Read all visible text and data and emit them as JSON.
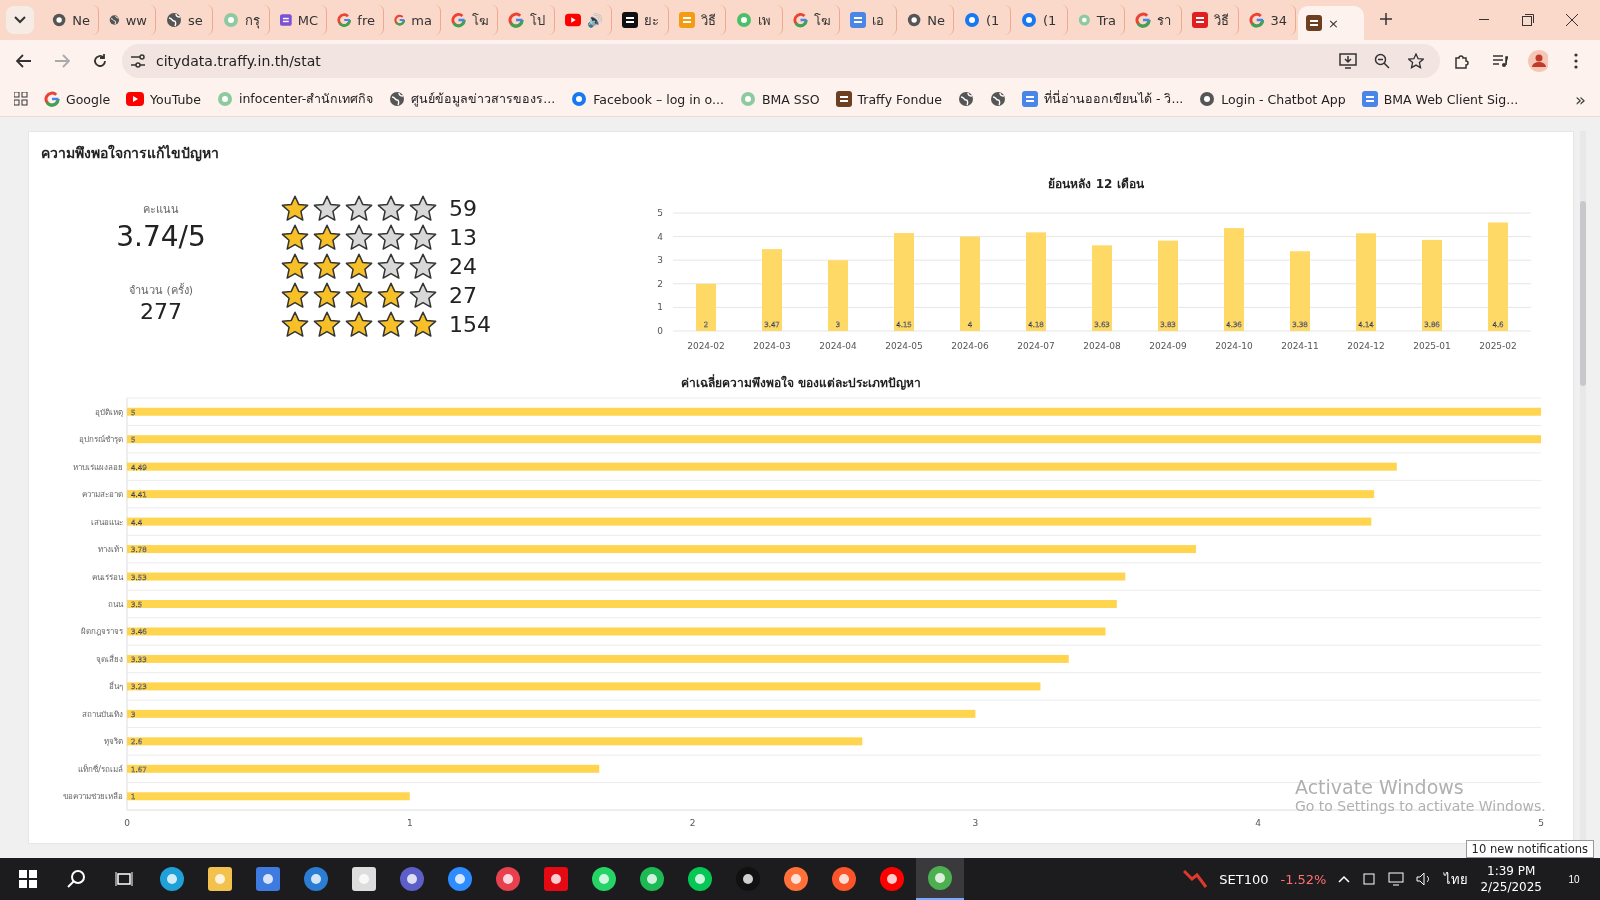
{
  "browser": {
    "tabs": [
      {
        "kind": "chrome",
        "label": "Ne",
        "selected": false
      },
      {
        "kind": "globe",
        "label": "ww",
        "selected": false
      },
      {
        "kind": "globe",
        "label": "se",
        "selected": false
      },
      {
        "kind": "emblem",
        "label": "กรุ",
        "selected": false
      },
      {
        "kind": "printer",
        "label": "MC",
        "selected": false
      },
      {
        "kind": "google",
        "label": "fre",
        "selected": false
      },
      {
        "kind": "google",
        "label": "ma",
        "selected": false
      },
      {
        "kind": "google",
        "label": "โฆ",
        "selected": false
      },
      {
        "kind": "google",
        "label": "โป",
        "selected": false
      },
      {
        "kind": "youtube",
        "label": "🔊",
        "selected": false
      },
      {
        "kind": "n",
        "label": "ยะ",
        "selected": false
      },
      {
        "kind": "orange",
        "label": "วิธี",
        "selected": false
      },
      {
        "kind": "green",
        "label": "เพ",
        "selected": false
      },
      {
        "kind": "google",
        "label": "โฆ",
        "selected": false
      },
      {
        "kind": "doc",
        "label": "เอ",
        "selected": false
      },
      {
        "kind": "chrome",
        "label": "Ne",
        "selected": false
      },
      {
        "kind": "facebook",
        "label": "(1",
        "selected": false
      },
      {
        "kind": "facebook",
        "label": "(1",
        "selected": false
      },
      {
        "kind": "emblem",
        "label": "Tra",
        "selected": false
      },
      {
        "kind": "google",
        "label": "รา",
        "selected": false
      },
      {
        "kind": "red",
        "label": "วิธี",
        "selected": false
      },
      {
        "kind": "google",
        "label": "34",
        "selected": false
      },
      {
        "kind": "fondue",
        "label": "×",
        "selected": true
      }
    ],
    "url": "citydata.traffy.in.th/stat",
    "bookmarks": [
      {
        "kind": "google",
        "label": "Google"
      },
      {
        "kind": "youtube",
        "label": "YouTube"
      },
      {
        "kind": "emblem",
        "label": "infocenter-สำนักเทศกิจ"
      },
      {
        "kind": "globe",
        "label": "ศูนย์ข้อมูลข่าวสารของร..."
      },
      {
        "kind": "facebook",
        "label": "Facebook – log in o..."
      },
      {
        "kind": "emblem",
        "label": "BMA SSO"
      },
      {
        "kind": "fondue",
        "label": "Traffy Fondue"
      },
      {
        "kind": "globe"
      },
      {
        "kind": "globe"
      },
      {
        "kind": "doc",
        "label": "ที่นี่อ่านออกเขียนได้ - วิ..."
      },
      {
        "kind": "chrome",
        "label": "Login - Chatbot App"
      },
      {
        "kind": "doc",
        "label": "BMA Web Client Sig..."
      }
    ],
    "more": "»"
  },
  "card": {
    "title": "ความพึงพอใจการแก้ไขปัญหา",
    "score_label": "คะแนน",
    "score": "3.74/5",
    "count_label": "จำนวน (ครั้ง)",
    "count": "277",
    "ratings": [
      {
        "stars": 1,
        "count": "59"
      },
      {
        "stars": 2,
        "count": "13"
      },
      {
        "stars": 3,
        "count": "24"
      },
      {
        "stars": 4,
        "count": "27"
      },
      {
        "stars": 5,
        "count": "154"
      }
    ],
    "monthly": {
      "chart_data": {
        "type": "bar",
        "title": "ย้อนหลัง 12 เดือน",
        "categories": [
          "2024-02",
          "2024-03",
          "2024-04",
          "2024-05",
          "2024-06",
          "2024-07",
          "2024-08",
          "2024-09",
          "2024-10",
          "2024-11",
          "2024-12",
          "2025-01",
          "2025-02"
        ],
        "values": [
          2,
          3.47,
          3,
          4.15,
          4,
          4.18,
          3.63,
          3.83,
          4.36,
          3.38,
          4.14,
          3.86,
          4.6
        ],
        "ylim": [
          0,
          5
        ],
        "yticks": [
          0,
          1,
          2,
          3,
          4,
          5
        ],
        "data_labels": true,
        "grid": true
      }
    },
    "by_type": {
      "chart_data": {
        "type": "bar",
        "orientation": "horizontal",
        "title": "ค่าเฉลี่ยความพึงพอใจ ของแต่ละประเภทปัญหา",
        "categories": [
          "อุบัติเหตุ",
          "อุปกรณ์ชำรุด",
          "หาบเร่แผงลอย",
          "ความสะอาด",
          "เสนอแนะ",
          "ทางเท้า",
          "คนเร่ร่อน",
          "ถนน",
          "ผิดกฎจราจร",
          "จุดเสี่ยง",
          "อื่นๆ",
          "สถานบันเทิง",
          "ทุจริต",
          "แท็กซี่/รถเมล์",
          "ขอความช่วยเหลือ"
        ],
        "values": [
          5,
          5,
          4.49,
          4.41,
          4.4,
          3.78,
          3.53,
          3.5,
          3.46,
          3.33,
          3.23,
          3,
          2.6,
          1.67,
          1
        ],
        "xlim": [
          0,
          5
        ],
        "xticks": [
          0,
          1,
          2,
          3,
          4,
          5
        ],
        "data_labels": true,
        "grid": true
      }
    }
  },
  "activation": {
    "title": "Activate Windows",
    "hint": "Go to Settings to activate Windows."
  },
  "notification_tip": "10 new notifications",
  "taskbar": {
    "apps": [
      {
        "kind": "edge",
        "selected": false
      },
      {
        "kind": "folder",
        "selected": false
      },
      {
        "kind": "store",
        "selected": false
      },
      {
        "kind": "mail",
        "selected": false
      },
      {
        "kind": "calculator",
        "selected": false
      },
      {
        "kind": "teams",
        "selected": false
      },
      {
        "kind": "video",
        "selected": false
      },
      {
        "kind": "record",
        "selected": false
      },
      {
        "kind": "netflix",
        "selected": false
      },
      {
        "kind": "chat",
        "selected": false
      },
      {
        "kind": "music",
        "selected": false
      },
      {
        "kind": "line",
        "selected": false
      },
      {
        "kind": "note",
        "selected": false
      },
      {
        "kind": "fox",
        "selected": false
      },
      {
        "kind": "lion",
        "selected": false
      },
      {
        "kind": "youtube",
        "selected": false
      },
      {
        "kind": "chrome",
        "selected": true
      }
    ],
    "ticker": "SET100",
    "change": "-1.52%",
    "language": "ไทย",
    "time": "1:39 PM",
    "date": "2/25/2025",
    "notifications": "10"
  }
}
